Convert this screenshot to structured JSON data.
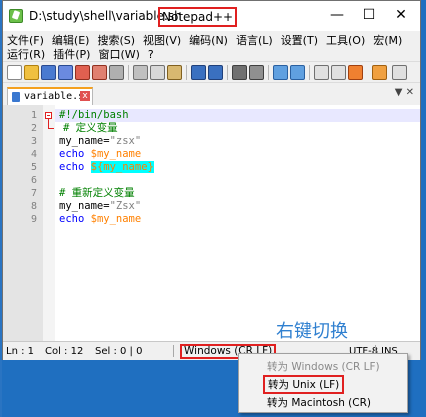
{
  "window": {
    "title_path": "D:\\study\\shell\\variable.sh",
    "title_app": "Notepad++",
    "min_glyph": "—",
    "max_glyph": "☐",
    "close_glyph": "✕"
  },
  "menu": {
    "row1": [
      "文件(F)",
      "编辑(E)",
      "搜索(S)",
      "视图(V)",
      "编码(N)",
      "语言(L)",
      "设置(T)",
      "工具(O)",
      "宏(M)"
    ],
    "row2": [
      "运行(R)",
      "插件(P)",
      "窗口(W)",
      "?"
    ]
  },
  "tab": {
    "label": "variable.sh",
    "close": "x",
    "right_glyph": "▼ ✕"
  },
  "editor": {
    "lines": [
      {
        "n": "1",
        "tokens": [
          {
            "t": "#!/bin/bash",
            "c": "c-comment"
          }
        ]
      },
      {
        "n": "2",
        "tokens": [
          {
            "t": "# 定义变量",
            "c": "c-comment"
          }
        ]
      },
      {
        "n": "3",
        "tokens": [
          {
            "t": "my_name",
            "c": "c-var"
          },
          {
            "t": "=",
            "c": "c-op"
          },
          {
            "t": "\"zsx\"",
            "c": "c-str"
          }
        ]
      },
      {
        "n": "4",
        "tokens": [
          {
            "t": "echo",
            "c": "c-kw"
          },
          {
            "t": " ",
            "c": "c-var"
          },
          {
            "t": "$my_name",
            "c": "c-ref"
          }
        ]
      },
      {
        "n": "5",
        "tokens": [
          {
            "t": "echo",
            "c": "c-kw"
          },
          {
            "t": " ",
            "c": "c-var"
          },
          {
            "t": "${my_name}",
            "c": "c-ref-hl"
          }
        ]
      },
      {
        "n": "6",
        "tokens": []
      },
      {
        "n": "7",
        "tokens": [
          {
            "t": "# 重新定义变量",
            "c": "c-comment"
          }
        ]
      },
      {
        "n": "8",
        "tokens": [
          {
            "t": "my_name",
            "c": "c-var"
          },
          {
            "t": "=",
            "c": "c-op"
          },
          {
            "t": "\"Zsx\"",
            "c": "c-str"
          }
        ]
      },
      {
        "n": "9",
        "tokens": [
          {
            "t": "echo",
            "c": "c-kw"
          },
          {
            "t": " ",
            "c": "c-var"
          },
          {
            "t": "$my_name",
            "c": "c-ref"
          }
        ]
      }
    ]
  },
  "status": {
    "ln": "Ln : 1",
    "col": "Col : 12",
    "sel": "Sel : 0 | 0",
    "eol": "Windows (CR LF)",
    "encoding": "UTF-8",
    "mode": "INS"
  },
  "annotation": "右键切换",
  "context_menu": {
    "items": [
      {
        "label": "转为 Windows (CR LF)",
        "state": "disabled"
      },
      {
        "label": "转为 Unix (LF)",
        "state": "highlighted"
      },
      {
        "label": "转为 Macintosh (CR)",
        "state": "normal"
      }
    ]
  },
  "colors": {
    "desktop": "#1f6fc0",
    "highlight_box": "#e02020",
    "comment": "#008000",
    "keyword": "#0000ff",
    "variable_ref": "#ff8000",
    "annotation": "#3080d0"
  }
}
